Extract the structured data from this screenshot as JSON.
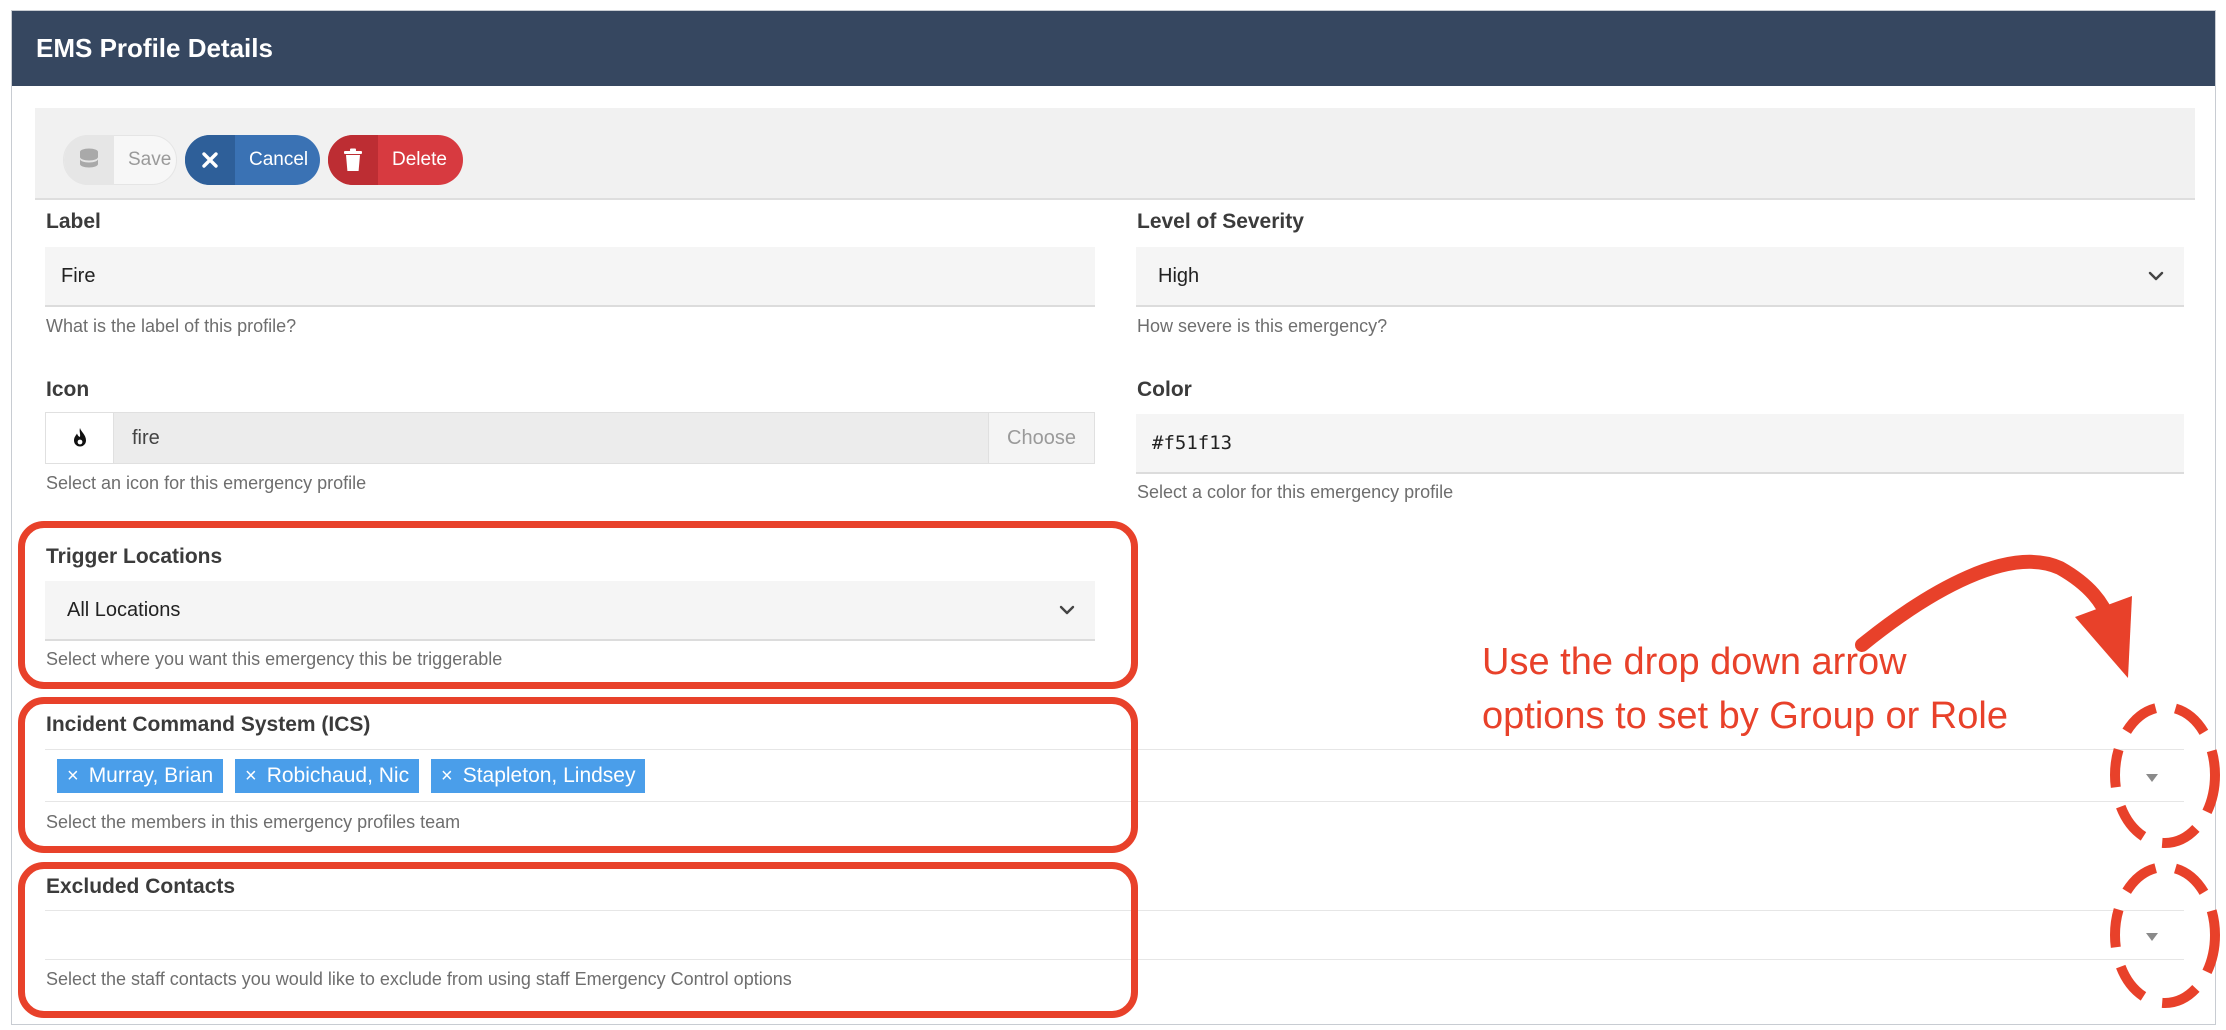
{
  "header": {
    "title": "EMS Profile Details"
  },
  "toolbar": {
    "save_label": "Save",
    "cancel_label": "Cancel",
    "delete_label": "Delete"
  },
  "form": {
    "label": {
      "title": "Label",
      "value": "Fire",
      "help": "What is the label of this profile?"
    },
    "severity": {
      "title": "Level of Severity",
      "value": "High",
      "help": "How severe is this emergency?"
    },
    "icon": {
      "title": "Icon",
      "value": "fire",
      "choose": "Choose",
      "help": "Select an icon for this emergency profile",
      "icon_name": "fire-icon"
    },
    "color": {
      "title": "Color",
      "value": "#f51f13",
      "help": "Select a color for this emergency profile"
    },
    "trigger": {
      "title": "Trigger Locations",
      "value": "All Locations",
      "help": "Select where you want this emergency this be triggerable"
    },
    "ics": {
      "title": "Incident Command System (ICS)",
      "members": [
        "Murray, Brian",
        "Robichaud, Nic",
        "Stapleton, Lindsey"
      ],
      "help": "Select the members in this emergency profiles team"
    },
    "excluded": {
      "title": "Excluded Contacts",
      "help": "Select the staff contacts you would like to exclude from using staff Emergency Control options"
    }
  },
  "annotation": {
    "line1": "Use the drop down arrow",
    "line2": "options to set by Group or Role",
    "color": "#e8412a"
  },
  "colors": {
    "header_bg": "#364760",
    "cancel": "#3a72b4",
    "delete": "#d73a40",
    "tag": "#4a9eea"
  }
}
